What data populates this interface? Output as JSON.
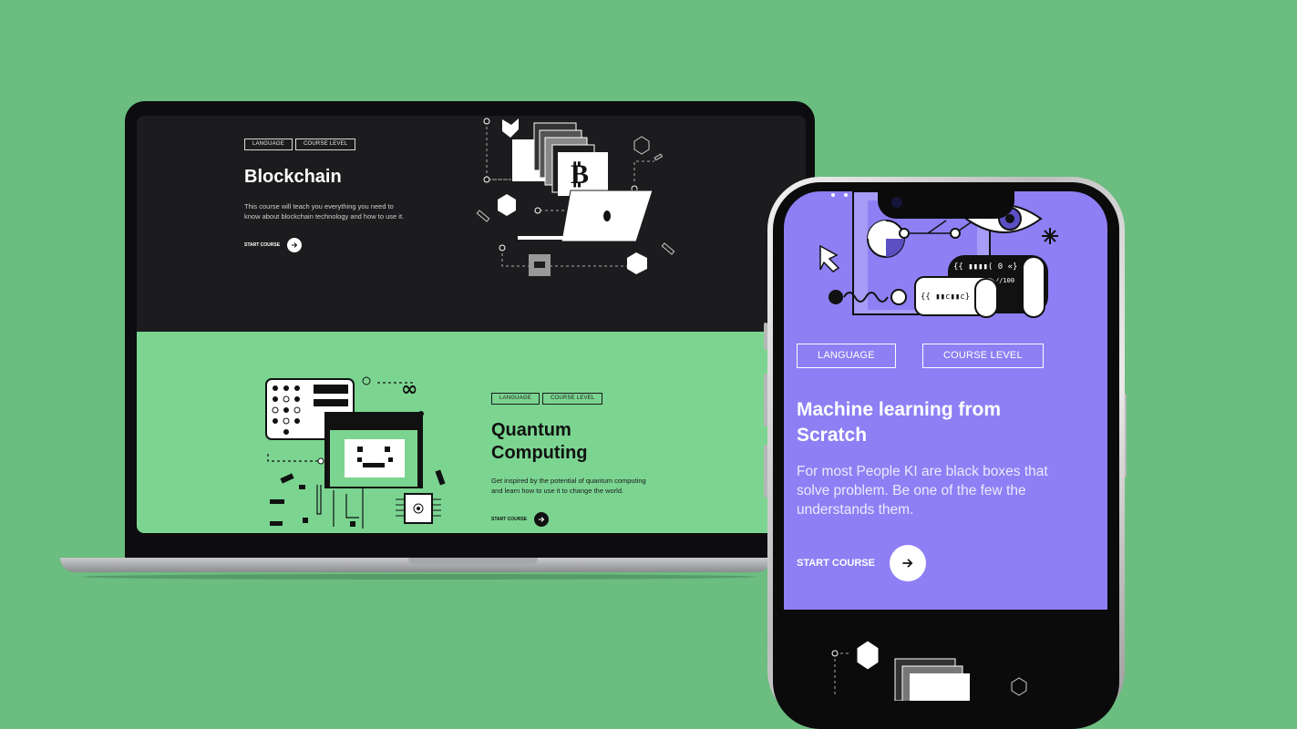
{
  "laptop": {
    "blockchain": {
      "tags": [
        "LANGUAGE",
        "COURSE LEVEL"
      ],
      "title": "Blockchain",
      "description_lines": [
        "This course will teach you everything you need to",
        "know about blockchain technology and how to use it."
      ],
      "cta_label": "START COURSE",
      "cta_icon": "arrow-right-icon"
    },
    "quantum": {
      "tags": [
        "LANGUAGE",
        "COURSE LEVEL"
      ],
      "title_lines": [
        "Quantum",
        "Computing"
      ],
      "description_lines": [
        "Get inspired by the potential of quantum computing",
        "and learn how to use it to change the world."
      ],
      "cta_label": "START COURSE",
      "cta_icon": "arrow-right-icon"
    }
  },
  "phone": {
    "tags": [
      "LANGUAGE",
      "COURSE LEVEL"
    ],
    "title_lines": [
      "Machine learning from",
      "Scratch"
    ],
    "description_lines": [
      "For most People KI are black boxes that",
      "solve problem. Be one of the few the",
      "understands them."
    ],
    "cta_label": "START COURSE",
    "cta_icon": "arrow-right-icon",
    "illustration_labels": [
      "{{ ▮▮▮▮( 0 «}",
      "{{ ▮▮c▮▮c}"
    ]
  },
  "colors": {
    "background": "#6bbd80",
    "laptop_dark": "#1c1c1e",
    "laptop_green": "#7bd591",
    "phone_purple": "#8e7ff4"
  }
}
